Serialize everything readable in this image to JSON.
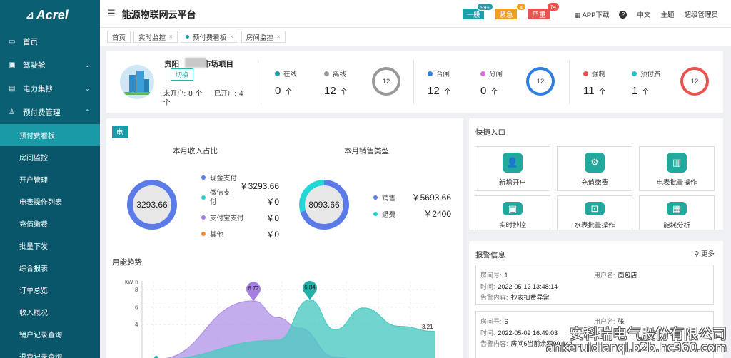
{
  "sidebar": {
    "logo": "Acrel",
    "items": [
      {
        "label": "首页",
        "icon": "monitor-icon"
      },
      {
        "label": "驾驶舱",
        "icon": "dashboard-icon"
      },
      {
        "label": "电力集抄",
        "icon": "meter-icon"
      },
      {
        "label": "预付费管理",
        "icon": "user-icon"
      }
    ],
    "sub_items": [
      "预付费看板",
      "房间监控",
      "开户管理",
      "电表操作列表",
      "充值缴费",
      "批量下发",
      "综合报表",
      "订单总览",
      "收入概况",
      "销户记录查询",
      "退费记录查询"
    ]
  },
  "header": {
    "title": "能源物联网云平台",
    "alerts": [
      {
        "label": "一般",
        "count": "99+",
        "color": "#1aa0a8"
      },
      {
        "label": "紧急",
        "count": "4",
        "color": "#f0a020"
      },
      {
        "label": "严重",
        "count": "74",
        "color": "#e8544d"
      }
    ],
    "app_download": "APP下载",
    "language": "中文",
    "theme": "主题",
    "user": "超级管理员"
  },
  "tabs": [
    "首页",
    "实时监控",
    "预付费看板",
    "房间监控"
  ],
  "project": {
    "name_prefix": "贵阳",
    "name_suffix": "市场项目",
    "switch": "切换",
    "unopened_label": "未开户:",
    "unopened": "8",
    "opened_label": "已开户:",
    "opened": "4",
    "unit": "个",
    "groups": [
      {
        "stats": [
          {
            "label": "在线",
            "value": "0",
            "color": "#1aa0a8"
          },
          {
            "label": "离线",
            "value": "12",
            "color": "#999999"
          }
        ],
        "total": "12",
        "ring_color": "#999999"
      },
      {
        "stats": [
          {
            "label": "合闸",
            "value": "12",
            "color": "#2f7fe0"
          },
          {
            "label": "分闸",
            "value": "0",
            "color": "#d86ee0"
          }
        ],
        "total": "12",
        "ring_color": "#2f7fe0"
      },
      {
        "stats": [
          {
            "label": "强制",
            "value": "11",
            "color": "#e8544d"
          },
          {
            "label": "预付费",
            "value": "1",
            "color": "#24c2c2"
          }
        ],
        "total": "12",
        "ring_color": "#e8544d"
      }
    ]
  },
  "main": {
    "tag": "电",
    "income": {
      "title": "本月收入占比",
      "total": "3293.66",
      "legend": [
        {
          "label": "现金支付",
          "amount": "￥3293.66",
          "color": "#5b7be8"
        },
        {
          "label": "微信支付",
          "amount": "￥0",
          "color": "#34d0c4"
        },
        {
          "label": "支付宝支付",
          "amount": "￥0",
          "color": "#a47ee0"
        },
        {
          "label": "其他",
          "amount": "￥0",
          "color": "#f08b3a"
        }
      ]
    },
    "sales": {
      "title": "本月销售类型",
      "total": "8093.66",
      "legend": [
        {
          "label": "销售",
          "amount": "￥5693.66",
          "color": "#5b7be8"
        },
        {
          "label": "退费",
          "amount": "￥2400",
          "color": "#24d6d6"
        }
      ]
    },
    "trend_title": "用能趋势"
  },
  "chart_data": {
    "type": "area",
    "ylabel": "kW·h",
    "yticks": [
      "8",
      "6",
      "4"
    ],
    "ylim": [
      0,
      9
    ],
    "series": [
      {
        "values": [
          0,
          6.72,
          4.8,
          3.6,
          0.3,
          0
        ],
        "color": "#b091e6"
      },
      {
        "values": [
          0,
          2.2,
          6.84,
          3.4,
          5.9,
          3.8,
          3.21
        ],
        "color": "#4dcbc2"
      }
    ],
    "labels": [
      "6.72",
      "6.84",
      "3.21"
    ]
  },
  "quick": {
    "title": "快捷入口",
    "items": [
      {
        "label": "新增开户",
        "icon": "add-user-icon"
      },
      {
        "label": "充值缴费",
        "icon": "recharge-icon"
      },
      {
        "label": "电表批量操作",
        "icon": "meter-batch-icon"
      },
      {
        "label": "实时抄控",
        "icon": "realtime-icon"
      },
      {
        "label": "水表批量操作",
        "icon": "water-meter-icon"
      },
      {
        "label": "能耗分析",
        "icon": "analysis-icon"
      }
    ]
  },
  "alarms": {
    "title": "报警信息",
    "more": "更多",
    "room_label": "房间号:",
    "user_label": "用户名:",
    "time_label": "时间:",
    "content_label": "告警内容:",
    "items": [
      {
        "room": "1",
        "user": "面包店",
        "time": "2022-05-12 13:48:14",
        "content": "抄表扣费异常"
      },
      {
        "room": "6",
        "user": "张",
        "time": "2022-05-09 16:49:03",
        "content": "房间6当前余额99.944"
      }
    ]
  },
  "watermark": {
    "line1": "安科瑞电气股份有限公司",
    "line2": "ankeruidianqi.b2b.hc360.com"
  }
}
